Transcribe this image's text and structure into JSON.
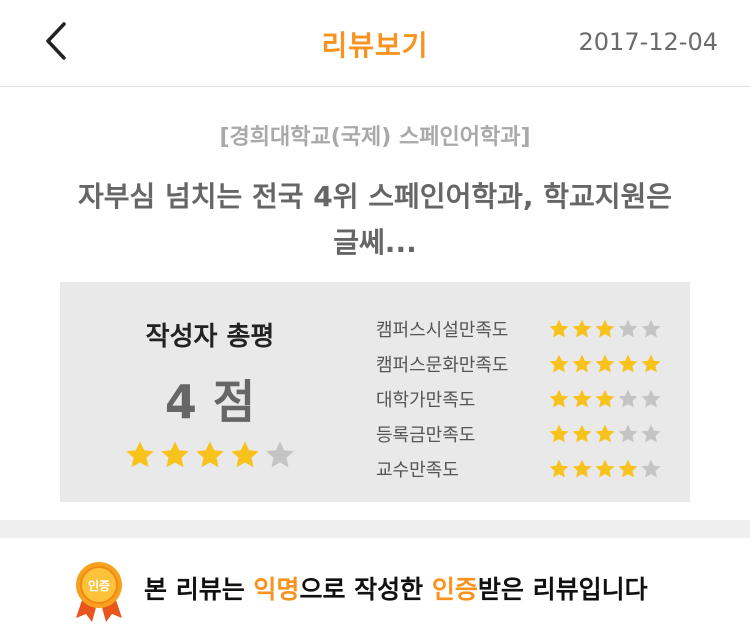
{
  "header": {
    "title": "리뷰보기",
    "date": "2017-12-04"
  },
  "review": {
    "school": "[경희대학교(국제) 스페인어학과]",
    "title_line1": "자부심 넘치는 전국 4위 스페인어학과, 학교지원은",
    "title_line2": "글쎄..."
  },
  "summary": {
    "overall_label": "작성자 총평",
    "score_text": "4 점",
    "overall_rating": 4,
    "max_rating": 5,
    "criteria": [
      {
        "label": "캠퍼스시설만족도",
        "rating": 3
      },
      {
        "label": "캠퍼스문화만족도",
        "rating": 5
      },
      {
        "label": "대학가만족도",
        "rating": 3
      },
      {
        "label": "등록금만족도",
        "rating": 3
      },
      {
        "label": "교수만족도",
        "rating": 4
      }
    ]
  },
  "notice": {
    "badge_text": "인증",
    "part1": "본 리뷰는 ",
    "anon": "익명",
    "part2": "으로 작성한 ",
    "verified": "인증",
    "part3": "받은 리뷰입니다"
  },
  "colors": {
    "accent": "#f7931e",
    "star_on": "#f8c21d",
    "star_off": "#c4c4c4"
  },
  "icons": {
    "back": "chevron-left-icon",
    "star": "star-icon",
    "badge": "verified-badge-icon"
  }
}
